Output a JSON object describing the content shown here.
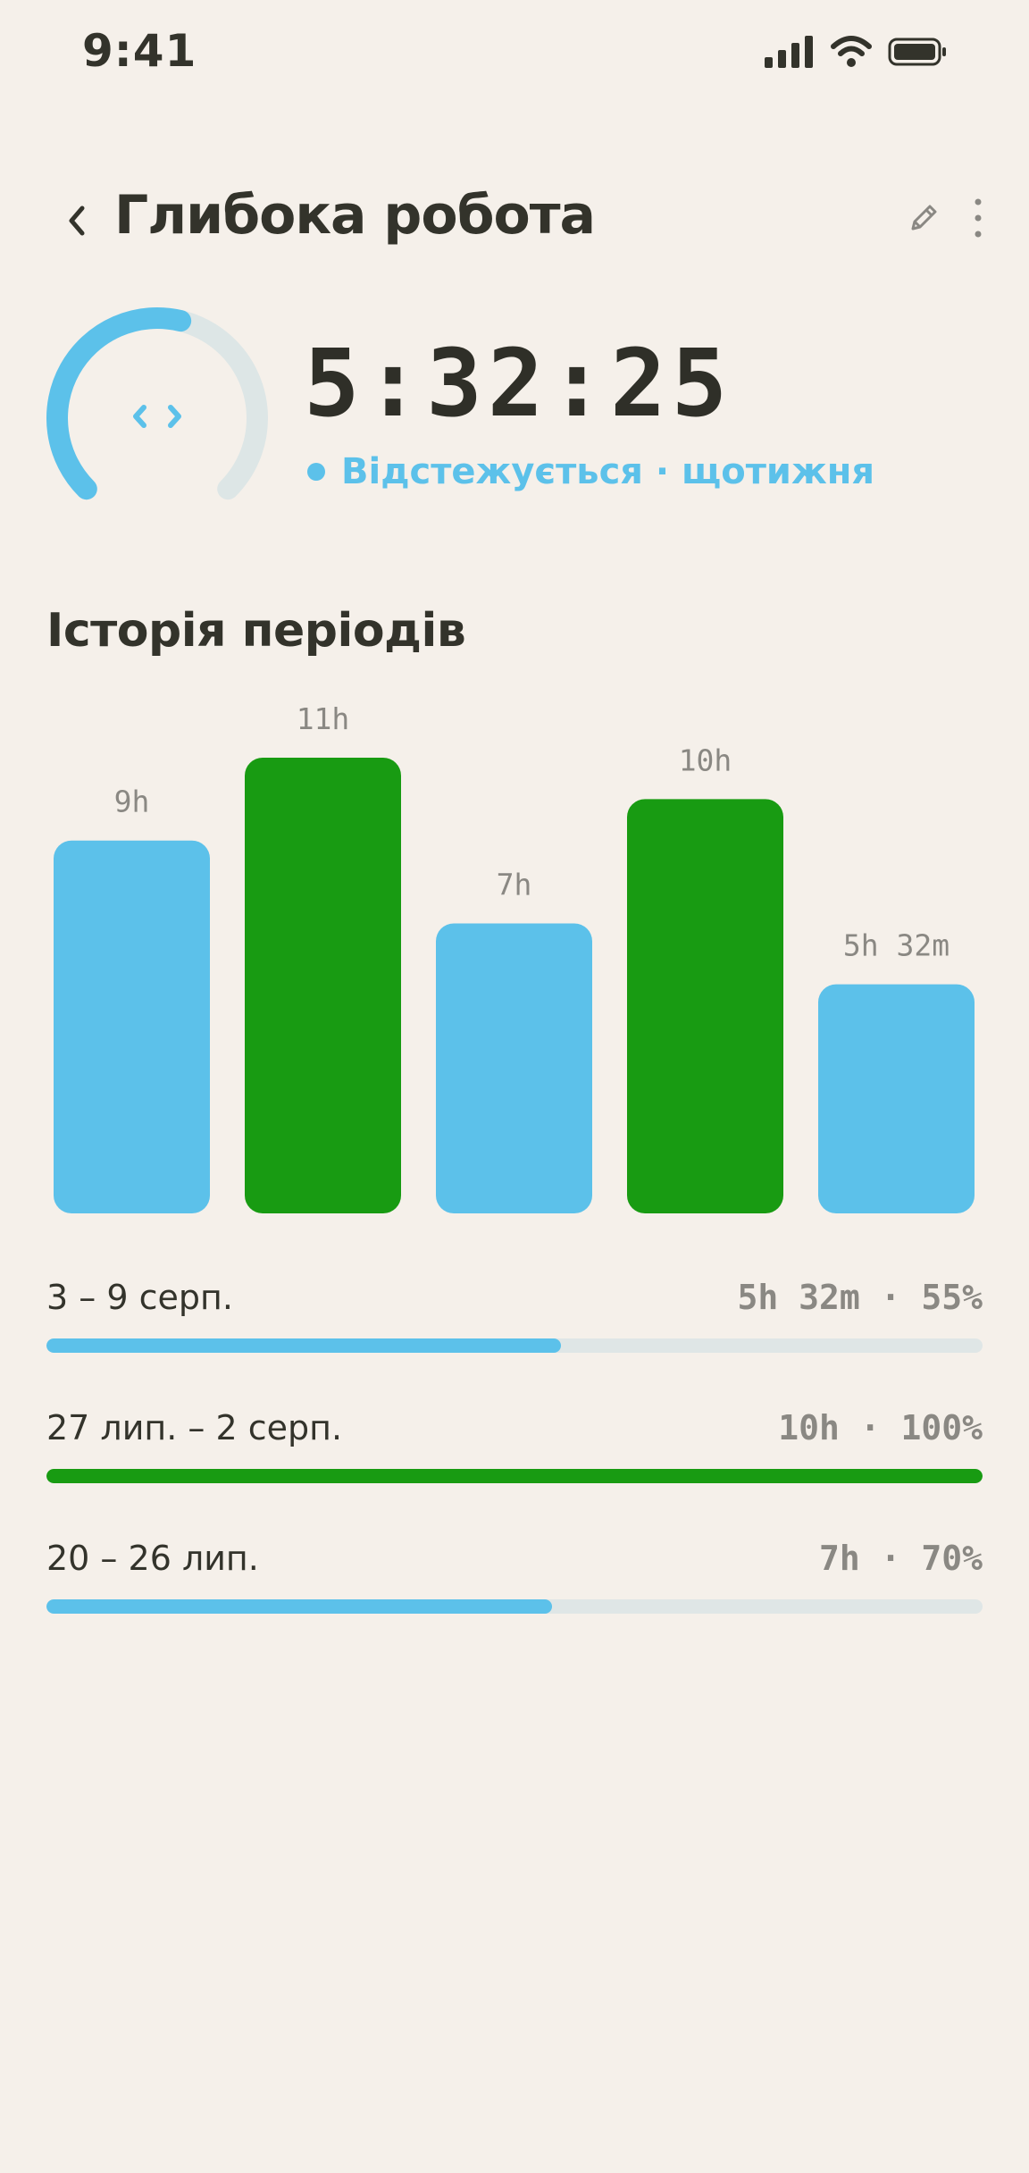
{
  "status_bar": {
    "time": "9:41"
  },
  "header": {
    "title": "Глибока робота"
  },
  "timer": {
    "value": "5:32:25",
    "tracking_label": "Відстежується · щотижня",
    "ring_progress": 0.55
  },
  "history": {
    "title": "Історія періодів"
  },
  "chart_data": {
    "type": "bar",
    "values": [
      9,
      11,
      7,
      10,
      5.53
    ],
    "value_labels": [
      "9h",
      "11h",
      "7h",
      "10h",
      "5h 32m"
    ],
    "bar_colors": [
      "#5cc1ea",
      "#189b12",
      "#5cc1ea",
      "#189b12",
      "#5cc1ea"
    ],
    "ylim": [
      0,
      11
    ]
  },
  "periods": [
    {
      "label": "3 – 9 серп.",
      "value": "5h 32m · 55%",
      "progress": 0.55,
      "color": "#5cc1ea"
    },
    {
      "label": "27 лип. – 2 серп.",
      "value": "10h · 100%",
      "progress": 1.0,
      "color": "#189b12"
    },
    {
      "label": "20 – 26 лип.",
      "value": "7h · 70%",
      "progress": 0.54,
      "color": "#5cc1ea"
    }
  ],
  "colors": {
    "background": "#f5f0ea",
    "accent_blue": "#5cc1ea",
    "accent_green": "#189b12",
    "track": "#dfe6e6",
    "text": "#33332b",
    "muted": "#8a8883"
  },
  "icons": {
    "back": "chevron-left-icon",
    "edit": "pencil-icon",
    "more": "more-vertical-icon",
    "task": "code-icon"
  }
}
